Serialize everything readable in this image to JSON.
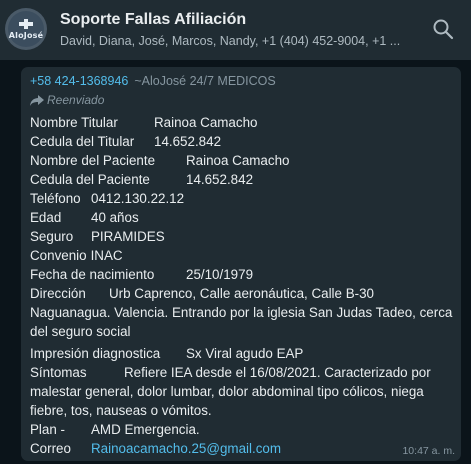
{
  "header": {
    "avatar_text": "AloJosé",
    "title": "Soporte Fallas Afiliación",
    "subtitle": "David, Diana, José, Marcos, Nandy, +1 (404) 452-9004, +1 ..."
  },
  "message": {
    "sender_phone": "+58 424-1368946",
    "sender_name": "~AloJosé 24/7 MEDICOS",
    "forwarded_label": "Reenviado",
    "fields": [
      {
        "label": "Nombre Titular",
        "value": "Rainoa Camacho"
      },
      {
        "label": "Cedula del Titular",
        "value": "14.652.842"
      },
      {
        "label": "Nombre del Paciente",
        "value": "Rainoa Camacho"
      },
      {
        "label": "Cedula del Paciente",
        "value": "14.652.842"
      },
      {
        "label": "Teléfono",
        "value": "0412.130.22.12"
      },
      {
        "label": "Edad",
        "value": "40 años"
      },
      {
        "label": "Seguro",
        "value": "PIRAMIDES"
      },
      {
        "label": "Convenio",
        "value": "INAC"
      },
      {
        "label": "Fecha de nacimiento",
        "value": "25/10/1979"
      },
      {
        "label": "Dirección",
        "value": "Urb Caprenco, Calle aeronáutica, Calle B-30 Naguanagua. Valencia. Entrando por la iglesia San Judas Tadeo, cerca del seguro social"
      },
      {
        "label": "Impresión diagnostica",
        "value": "Sx Viral agudo EAP"
      },
      {
        "label": "Síntomas",
        "value": "Refiere IEA desde el 16/08/2021.  Caracterizado por malestar general, dolor lumbar, dolor abdominal tipo cólicos, niega fiebre, tos, nauseas o vómitos."
      },
      {
        "label": "Plan -",
        "value": "AMD Emergencia."
      },
      {
        "label": "Correo",
        "value": "Rainoacamacho.25@gmail.com"
      }
    ],
    "time": "10:47 a. m."
  },
  "colors": {
    "header_bg": "#202c33",
    "chat_bg": "#0b141a",
    "bubble_bg": "#202c33",
    "text": "#e9edef",
    "muted": "#8696a0",
    "link": "#53bdeb"
  },
  "icons": {
    "search": "search-icon",
    "forward": "forward-arrow-icon",
    "avatar": "group-avatar"
  }
}
